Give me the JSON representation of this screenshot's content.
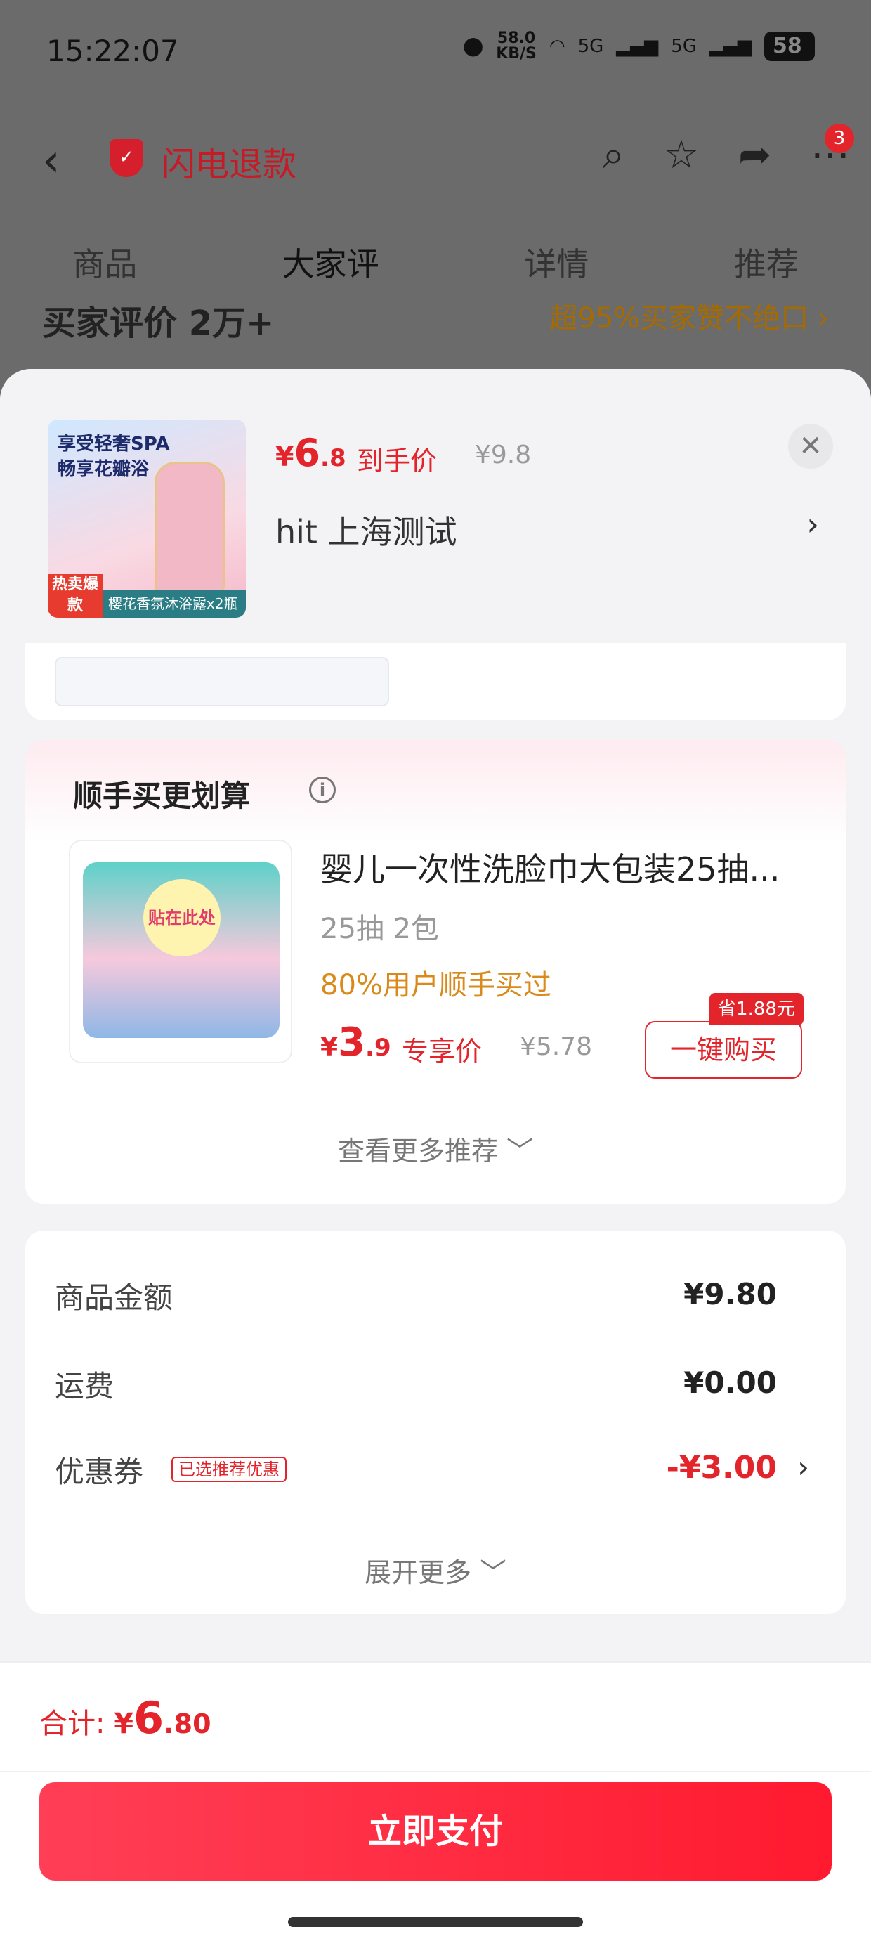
{
  "status_bar": {
    "time": "15:22:07",
    "net_speed": "58.0",
    "net_unit": "KB/S",
    "signal1": "5G",
    "signal2": "5G",
    "battery": "58"
  },
  "nav": {
    "refund_label": "闪电退款",
    "cart_count": "3"
  },
  "tabs": [
    "商品",
    "大家评",
    "详情",
    "推荐"
  ],
  "background_peek": {
    "left": "买家评价 2万+",
    "right": "超95%买家赞不绝口 ›"
  },
  "sheet": {
    "product": {
      "thumb_line1": "享受轻奢SPA",
      "thumb_line2": "畅享花瓣浴",
      "thumb_hot": "热卖爆款",
      "thumb_caption": "樱花香氛沐浴露x2瓶",
      "price_symbol": "¥",
      "price_int": "6",
      "price_dec": ".8",
      "price_tag": "到手价",
      "price_orig": "¥9.8",
      "variant": "hit  上海测试"
    },
    "bundle": {
      "title": "顺手买更划算",
      "item_name": "婴儿一次性洗脸巾大包装25抽...",
      "item_label": "贴在此处",
      "item_spec": "25抽 2包",
      "item_social": "80%用户顺手买过",
      "price_symbol": "¥",
      "price_int": "3",
      "price_dec": ".9",
      "price_tag": "专享价",
      "price_orig": "¥5.78",
      "buy_label": "一键购买",
      "save_badge": "省1.88元",
      "see_more": "查看更多推荐 ﹀"
    },
    "amounts": {
      "goods_label": "商品金额",
      "goods_value": "¥9.80",
      "shipping_label": "运费",
      "shipping_value": "¥0.00",
      "coupon_label": "优惠券",
      "coupon_tag": "已选推荐优惠",
      "coupon_value": "-¥3.00",
      "expand_more": "展开更多 ﹀"
    }
  },
  "footer": {
    "total_label": "合计: ",
    "total_symbol": "¥",
    "total_int": "6",
    "total_dec": ".80",
    "pay_label": "立即支付"
  },
  "colors": {
    "accent": "#e3242b",
    "pay_button": "#ff2a3f",
    "social_orange": "#d98a1a"
  }
}
